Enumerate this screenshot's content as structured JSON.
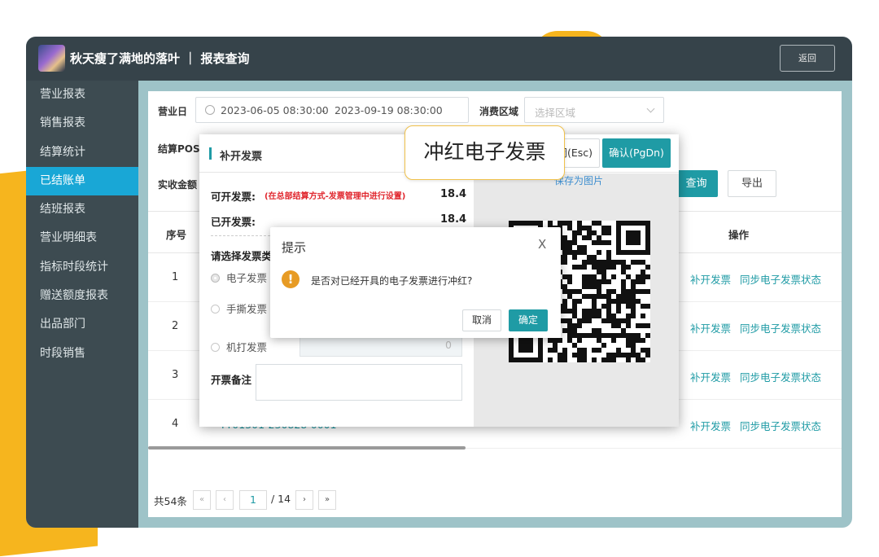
{
  "app": {
    "title": "秋天瘦了满地的落叶 ｜ 报表查询",
    "back_label": "返回"
  },
  "sidebar": {
    "items": [
      {
        "label": "营业报表"
      },
      {
        "label": "销售报表"
      },
      {
        "label": "结算统计"
      },
      {
        "label": "已结账单",
        "active": true
      },
      {
        "label": "结班报表"
      },
      {
        "label": "营业明细表"
      },
      {
        "label": "指标时段统计"
      },
      {
        "label": "赠送额度报表"
      },
      {
        "label": "出品部门"
      },
      {
        "label": "时段销售"
      }
    ]
  },
  "filters": {
    "date_label": "营业日",
    "date_start": "2023-06-05 08:30:00",
    "date_sep": "-",
    "date_end": "2023-09-19 08:30:00",
    "region_label": "消费区域",
    "region_placeholder": "选择区域",
    "pos_label": "结算POS",
    "amount_label": "实收金额",
    "query_label": "查询",
    "export_label": "导出"
  },
  "table": {
    "col_index": "序号",
    "col_action": "操作",
    "rows": [
      {
        "index": "1",
        "action1": "补开发票",
        "action2": "同步电子发票状态"
      },
      {
        "index": "2",
        "action1": "补开发票",
        "action2": "同步电子发票状态"
      },
      {
        "index": "3",
        "action1": "补开发票",
        "action2": "同步电子发票状态"
      },
      {
        "index": "4",
        "action1": "补开发票",
        "action2": "同步电子发票状态"
      }
    ],
    "visible_order_no": "YY01301-230828-0001"
  },
  "pager": {
    "total": "共54条",
    "first": "«",
    "prev": "‹",
    "page": "1",
    "of": "/ 14",
    "next": "›",
    "last": "»"
  },
  "invoice_modal": {
    "title": "补开发票",
    "close_label": "闭(Esc)",
    "confirm_label": "确认(PgDn)",
    "can_issue_label": "可开发票:",
    "can_issue_note": "(在总部结算方式-发票管理中进行设置)",
    "can_issue_value": "18.4",
    "issued_label": "已开发票:",
    "issued_value": "18.4",
    "type_label": "请选择发票类",
    "options": {
      "electronic": "电子发票",
      "manual": "手撕发票",
      "machine": "机打发票"
    },
    "machine_value": "0",
    "remark_label": "开票备注",
    "save_image_label": "保存为图片"
  },
  "callout": {
    "text": "冲红电子发票"
  },
  "confirm_dialog": {
    "title": "提示",
    "close": "X",
    "message": "是否对已经开具的电子发票进行冲红?",
    "cancel": "取消",
    "ok": "确定",
    "warn_glyph": "!"
  },
  "colors": {
    "accent": "#1f9ba5",
    "sidebar_active": "#19a7d6",
    "warn": "#e79b24",
    "note_red": "#e0262d"
  }
}
